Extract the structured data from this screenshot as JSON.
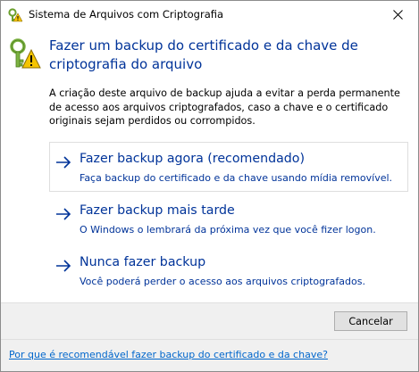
{
  "window": {
    "title": "Sistema de Arquivos com Criptografia"
  },
  "main": {
    "instruction": "Fazer um backup do certificado e da chave de criptografia do arquivo",
    "description": "A criação deste arquivo de backup ajuda a evitar a perda permanente de acesso aos arquivos criptografados, caso a chave e o certificado originais sejam perdidos ou corrompidos.",
    "options": [
      {
        "title": "Fazer backup agora (recomendado)",
        "subtitle": "Faça backup do certificado e da chave usando mídia removível."
      },
      {
        "title": "Fazer backup mais tarde",
        "subtitle": "O Windows o lembrará da próxima vez que você fizer logon."
      },
      {
        "title": "Nunca fazer backup",
        "subtitle": "Você poderá perder o acesso aos arquivos criptografados."
      }
    ]
  },
  "buttons": {
    "cancel_label": "Cancelar"
  },
  "footer": {
    "link_text": "Por que é recomendável fazer backup do certificado e da chave?"
  },
  "icons": {
    "title": "key-warning-icon",
    "header": "key-warning-icon",
    "close": "close-icon",
    "option_arrow": "arrow-right-icon"
  },
  "colors": {
    "instruction_text": "#003399",
    "link_text": "#003399",
    "footer_link": "#0066cc",
    "footer_background": "#f0f0f0",
    "button_background": "#e1e1e1",
    "key_green": "#7cb342",
    "warning_yellow": "#f5c400"
  }
}
